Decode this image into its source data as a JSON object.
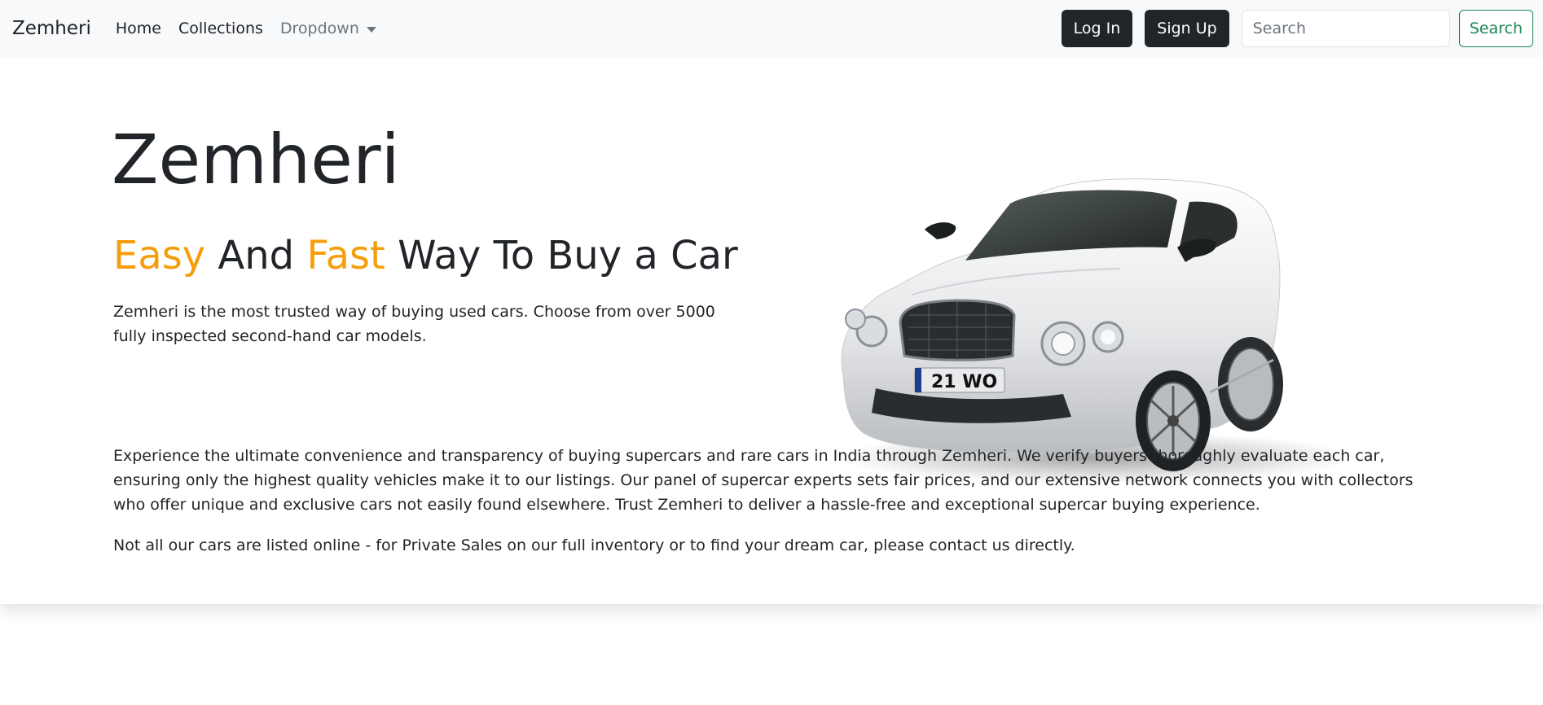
{
  "navbar": {
    "brand": "Zemheri",
    "links": [
      "Home",
      "Collections"
    ],
    "dropdown_label": "Dropdown",
    "login_label": "Log In",
    "signup_label": "Sign Up",
    "search_placeholder": "Search",
    "search_button_label": "Search"
  },
  "hero": {
    "title": "Zemheri",
    "tagline": {
      "word1": "Easy",
      "word2": " And ",
      "word3": "Fast",
      "word4": " Way To Buy a Car"
    },
    "lead": "Zemheri is the most trusted way of buying used cars. Choose from over 5000 fully inspected second-hand car models.",
    "paragraph1": "Experience the ultimate convenience and transparency of buying supercars and rare cars in India through Zemheri. We verify buyers thoroughly evaluate each car, ensuring only the highest quality vehicles make it to our listings. Our panel of supercar experts sets fair prices, and our extensive network connects you with collectors who offer unique and exclusive cars not easily found elsewhere. Trust Zemheri to deliver a hassle-free and exceptional supercar buying experience.",
    "paragraph2": "Not all our cars are listed online - for Private Sales on our full inventory or to find your dream car, please contact us directly.",
    "car_plate": "21 WO"
  },
  "colors": {
    "accent": "#f59e0b",
    "dark_button": "#212529",
    "success": "#198754",
    "navbar_bg": "#f8f9fa"
  },
  "icons": {
    "dropdown": "caret-down-icon",
    "hero_image": "car-image"
  }
}
